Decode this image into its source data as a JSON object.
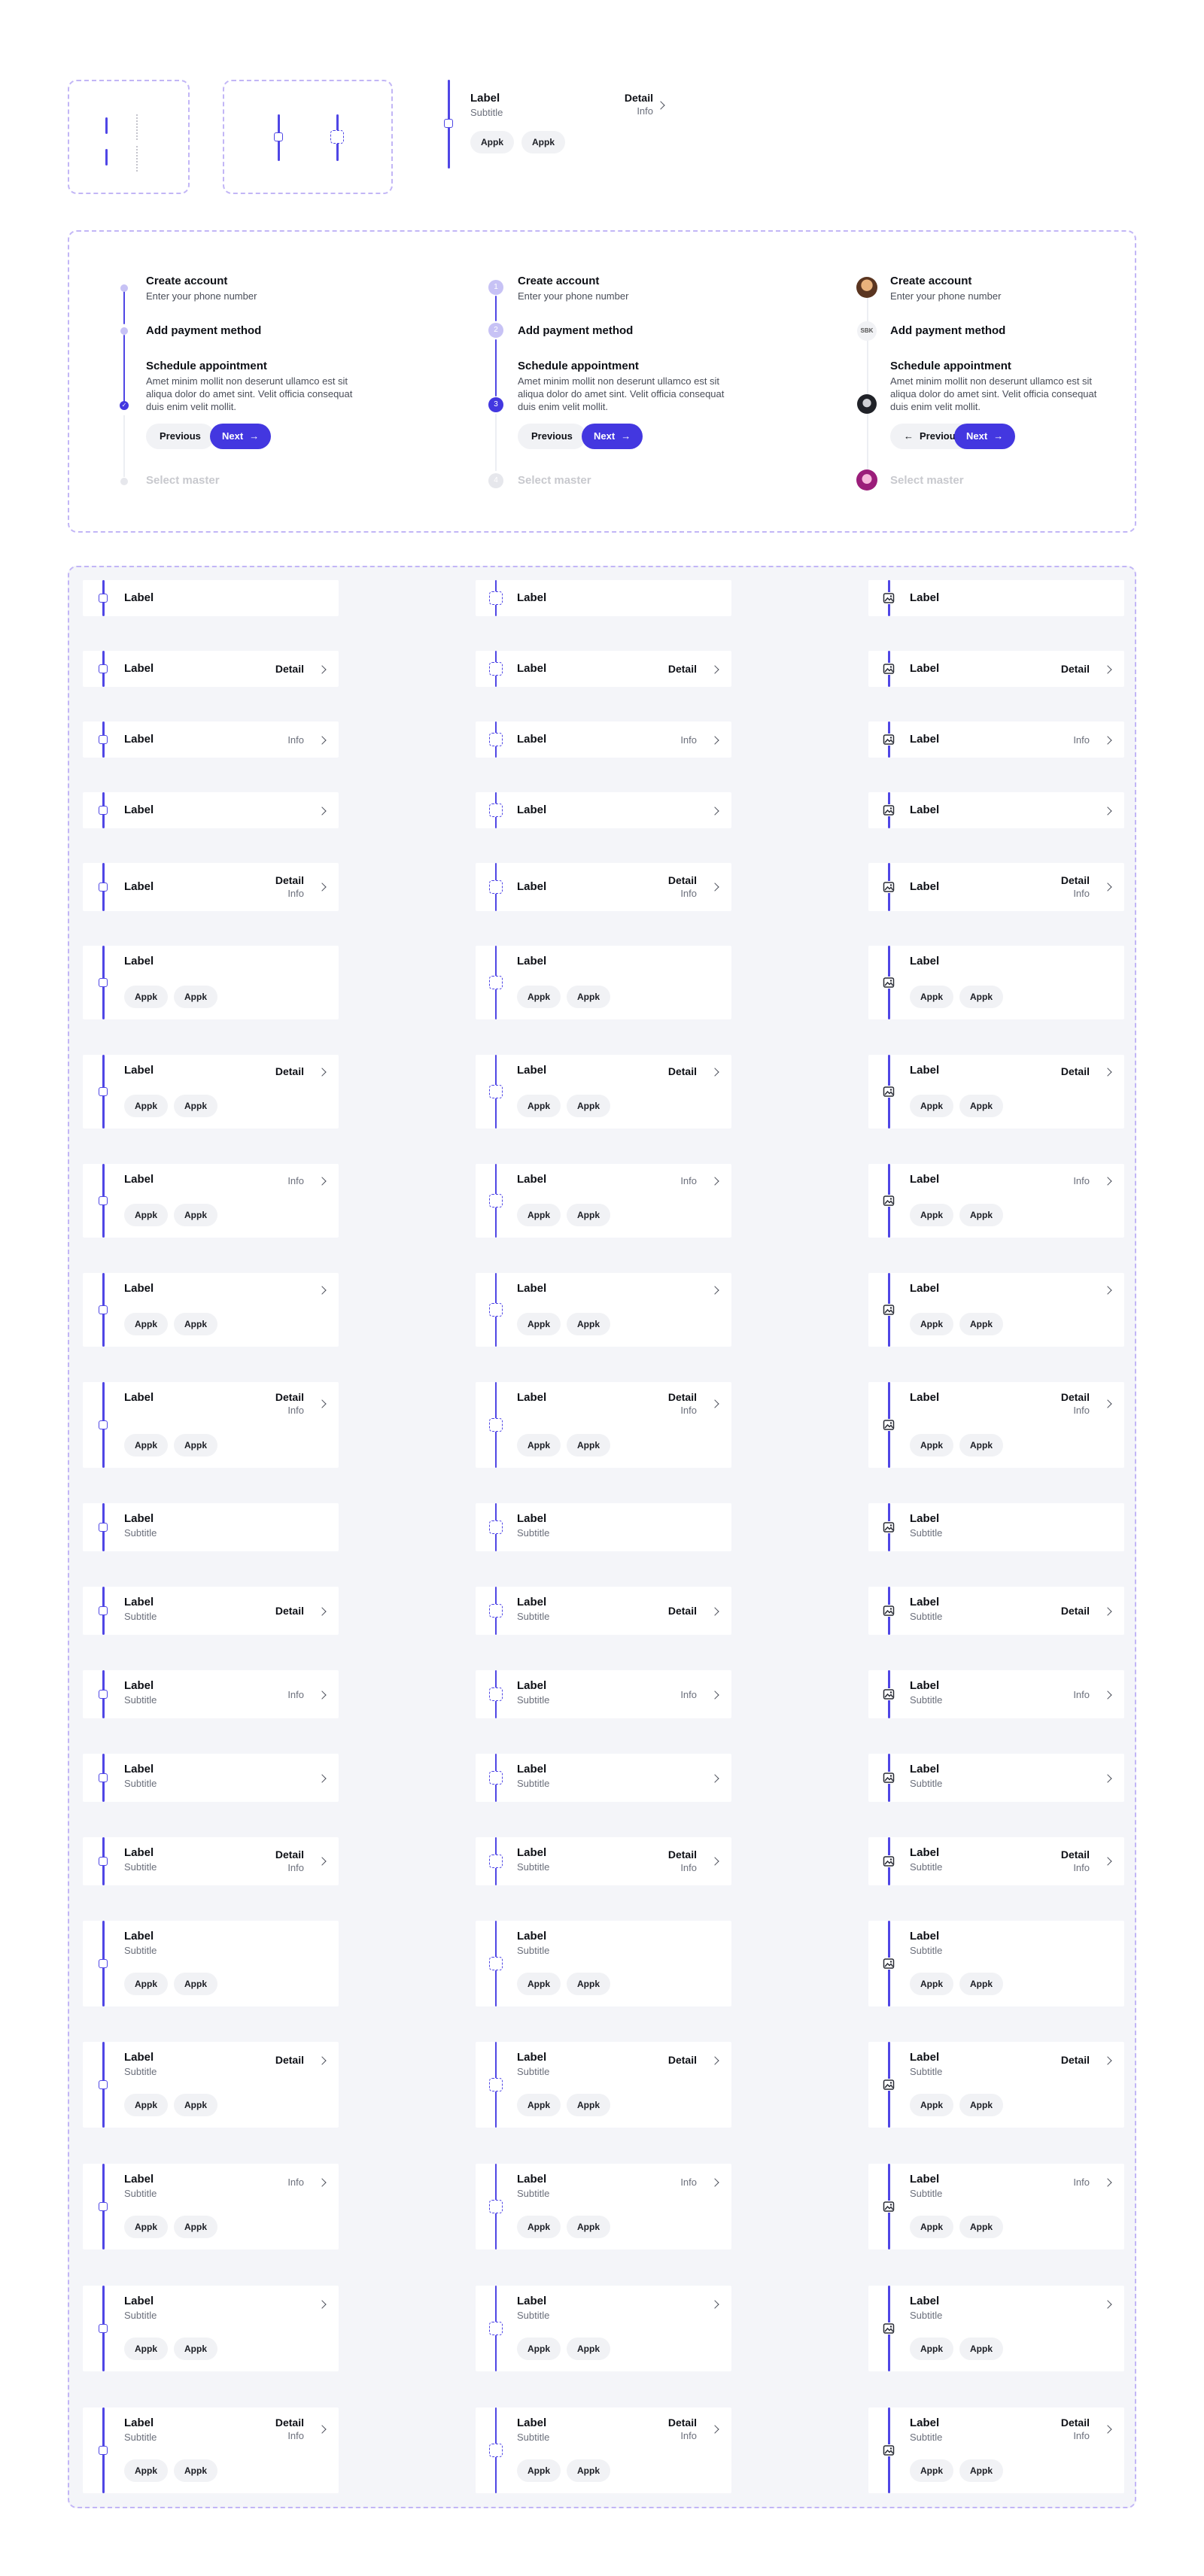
{
  "colors": {
    "accent": "#4f46e5",
    "dashed_border": "#c2b6f6",
    "area_bg": "#f4f5f9"
  },
  "top": {
    "label": "Label",
    "subtitle": "Subtitle",
    "detail": "Detail",
    "info": "Info",
    "chip1": "Appk",
    "chip2": "Appk"
  },
  "stepper": {
    "step1_title": "Create account",
    "step1_sub": "Enter your phone number",
    "step2_title": "Add payment method",
    "step3_title": "Schedule appointment",
    "step3_body": "Amet minim mollit non deserunt ullamco est sit aliqua dolor do amet sint. Velit officia consequat duis enim velit mollit.",
    "prev": "Previous",
    "next": "Next",
    "step4_title": "Select master",
    "numbers": [
      "1",
      "2",
      "3",
      "4"
    ],
    "sbk_badge": "SBK"
  },
  "cell": {
    "label": "Label",
    "subtitle": "Subtitle",
    "detail": "Detail",
    "info": "Info",
    "chip": "Appk"
  },
  "icons": [
    "square-node-icon",
    "dashed-square-node-icon",
    "image-icon",
    "chevron-right-icon",
    "check-icon",
    "arrow-right-icon",
    "arrow-left-icon",
    "avatar"
  ]
}
